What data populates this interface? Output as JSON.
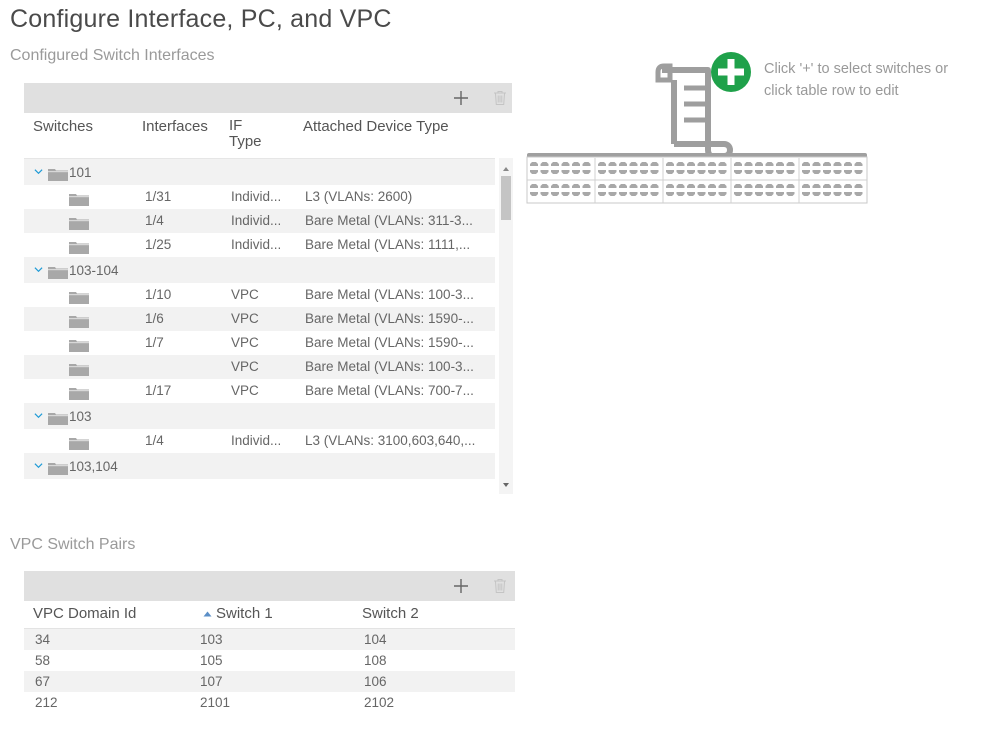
{
  "page": {
    "title": "Configure Interface, PC, and VPC"
  },
  "interfaces_section": {
    "title": "Configured Switch Interfaces",
    "toolbar": {
      "add_icon": "plus-icon",
      "delete_icon": "trash-icon"
    },
    "columns": [
      "Switches",
      "Interfaces",
      "IF Type",
      "Attached Device Type"
    ],
    "column_if_type_line1": "IF",
    "column_if_type_line2": "Type",
    "groups": [
      {
        "name": "101",
        "rows": [
          {
            "interface": "1/31",
            "if_type": "Individ...",
            "device": "L3 (VLANs: 2600)"
          },
          {
            "interface": "1/4",
            "if_type": "Individ...",
            "device": "Bare Metal (VLANs: 311-3..."
          },
          {
            "interface": "1/25",
            "if_type": "Individ...",
            "device": "Bare Metal (VLANs: 1111,..."
          }
        ]
      },
      {
        "name": "103-104",
        "rows": [
          {
            "interface": "1/10",
            "if_type": "VPC",
            "device": "Bare Metal (VLANs: 100-3..."
          },
          {
            "interface": "1/6",
            "if_type": "VPC",
            "device": "Bare Metal (VLANs: 1590-..."
          },
          {
            "interface": "1/7",
            "if_type": "VPC",
            "device": "Bare Metal (VLANs: 1590-..."
          },
          {
            "interface": "",
            "if_type": "VPC",
            "device": "Bare Metal (VLANs: 100-3..."
          },
          {
            "interface": "1/17",
            "if_type": "VPC",
            "device": "Bare Metal (VLANs: 700-7..."
          }
        ]
      },
      {
        "name": "103",
        "rows": [
          {
            "interface": "1/4",
            "if_type": "Individ...",
            "device": "L3 (VLANs: 3100,603,640,..."
          }
        ]
      },
      {
        "name": "103,104",
        "rows": []
      }
    ]
  },
  "vpc_section": {
    "title": "VPC Switch Pairs",
    "toolbar": {
      "add_icon": "plus-icon",
      "delete_icon": "trash-icon"
    },
    "columns": [
      "VPC Domain Id",
      "Switch 1",
      "Switch 2"
    ],
    "sorted_column": "Switch 1",
    "sort_direction": "ascending",
    "rows": [
      {
        "domain_id": "34",
        "switch1": "103",
        "switch2": "104"
      },
      {
        "domain_id": "58",
        "switch1": "105",
        "switch2": "108"
      },
      {
        "domain_id": "67",
        "switch1": "107",
        "switch2": "106"
      },
      {
        "domain_id": "212",
        "switch1": "2101",
        "switch2": "2102"
      }
    ]
  },
  "hint": {
    "line1": "Click '+' to select switches or",
    "line2": "click table row to edit"
  },
  "colors": {
    "accent_blue": "#1e9ad6",
    "add_green": "#1fa14a",
    "toolbar_gray": "#e0e0e0",
    "icon_gray": "#b3b3b3"
  }
}
